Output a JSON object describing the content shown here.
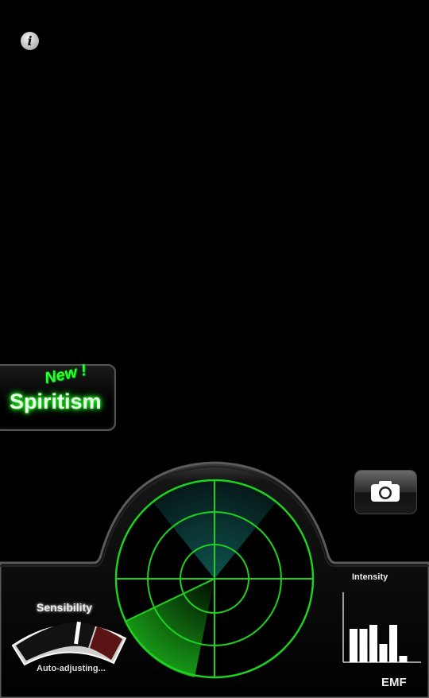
{
  "info_button": {
    "label": "i",
    "icon": "info-icon"
  },
  "spiritism": {
    "badge": "New !",
    "label": "Spiritism"
  },
  "camera_button": {
    "icon": "camera-icon"
  },
  "sensibility": {
    "title": "Sensibility",
    "status": "Auto-adjusting...",
    "level": 0.55
  },
  "intensity": {
    "title": "Intensity",
    "unit": "EMF",
    "bar_levels": [
      0.48,
      0.48,
      0.53,
      0.26,
      0.53,
      0.09
    ]
  },
  "colors": {
    "radar_green": "#1fd11f",
    "radar_cyan": "#1fa6a0",
    "glow_green": "#2eff2e"
  }
}
